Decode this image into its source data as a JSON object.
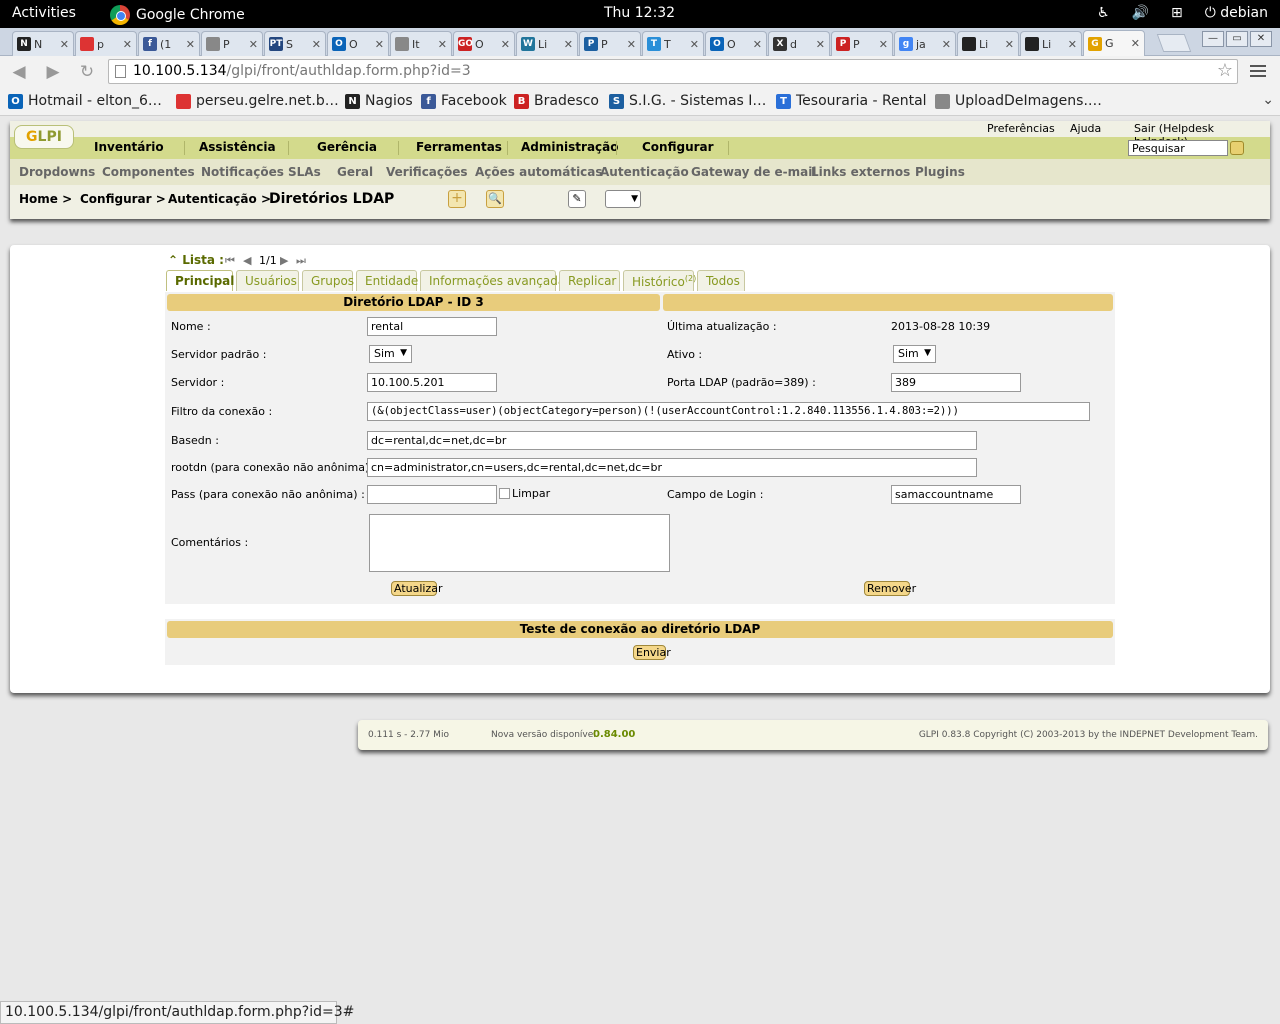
{
  "os_bar": {
    "activities": "Activities",
    "app": "Google Chrome",
    "clock": "Thu 12:32",
    "user": "debian"
  },
  "tabs": [
    {
      "title": "N",
      "icon": "N",
      "color": "#222"
    },
    {
      "title": "p",
      "icon": "",
      "color": "#d33"
    },
    {
      "title": "(1",
      "icon": "f",
      "color": "#3b5998"
    },
    {
      "title": "P",
      "icon": "",
      "color": "#888"
    },
    {
      "title": "S",
      "icon": "PT",
      "color": "#24477f"
    },
    {
      "title": "O",
      "icon": "O",
      "color": "#0a64b8"
    },
    {
      "title": "It",
      "icon": "",
      "color": "#888"
    },
    {
      "title": "O",
      "icon": "GO",
      "color": "#c22"
    },
    {
      "title": "Li",
      "icon": "W",
      "color": "#21759b"
    },
    {
      "title": "P",
      "icon": "P",
      "color": "#1c5fa0"
    },
    {
      "title": "T",
      "icon": "T",
      "color": "#2a8fd8"
    },
    {
      "title": "O",
      "icon": "O",
      "color": "#0a64b8"
    },
    {
      "title": "d",
      "icon": "X",
      "color": "#333"
    },
    {
      "title": "P",
      "icon": "P",
      "color": "#c22"
    },
    {
      "title": "ja",
      "icon": "g",
      "color": "#4285f4"
    },
    {
      "title": "Li",
      "icon": "",
      "color": "#222"
    },
    {
      "title": "Li",
      "icon": "",
      "color": "#222"
    },
    {
      "title": "G",
      "icon": "G",
      "color": "#e2a200"
    }
  ],
  "url": {
    "host": "10.100.5.134",
    "path": "/glpi/front/authldap.form.php?id=3"
  },
  "bookmarks": [
    {
      "label": "Hotmail - elton_6…",
      "icon": "O",
      "color": "#0a64b8"
    },
    {
      "label": "perseu.gelre.net.b…",
      "icon": "",
      "color": "#d33"
    },
    {
      "label": "Nagios",
      "icon": "N",
      "color": "#222"
    },
    {
      "label": "Facebook",
      "icon": "f",
      "color": "#3b5998"
    },
    {
      "label": "Bradesco",
      "icon": "B",
      "color": "#c22"
    },
    {
      "label": "S.I.G. - Sistemas I…",
      "icon": "S",
      "color": "#1c5fa0"
    },
    {
      "label": "Tesouraria - Rental",
      "icon": "T",
      "color": "#2a6fd8"
    },
    {
      "label": "UploadDeImagens.…",
      "icon": "",
      "color": "#888"
    }
  ],
  "glpi": {
    "logo": "GLPI",
    "main_menu": [
      "Inventário",
      "Assistência",
      "Gerência",
      "Ferramentas",
      "Administração",
      "Configurar"
    ],
    "top_links": [
      "Preferências",
      "Ajuda",
      "Sair (Helpdesk helpdesk)"
    ],
    "search_placeholder": "Pesquisar",
    "sub_menu": [
      "Dropdowns",
      "Componentes",
      "Notificações",
      "SLAs",
      "Geral",
      "Verificações",
      "Ações automáticas",
      "Autenticação",
      "Gateway de e-mail",
      "Links externos",
      "Plugins"
    ],
    "breadcrumb": [
      "Home >",
      "Configurar >",
      "Autenticação >"
    ],
    "page_title": "Diretórios LDAP"
  },
  "list_nav": {
    "label": "Lista :",
    "position": "1/1"
  },
  "form_tabs": [
    "Principal",
    "Usuários",
    "Grupos",
    "Entidade",
    "Informações avançadas",
    "Replicar",
    "Histórico",
    "Todos"
  ],
  "history_count": "(2)",
  "form": {
    "title": "Diretório LDAP - ID 3",
    "name_label": "Nome :",
    "name_value": "rental",
    "last_update_label": "Última atualização :",
    "last_update_value": "2013-08-28 10:39",
    "default_server_label": "Servidor padrão :",
    "default_server_value": "Sim",
    "active_label": "Ativo :",
    "active_value": "Sim",
    "server_label": "Servidor :",
    "server_value": "10.100.5.201",
    "port_label": "Porta LDAP (padrão=389) :",
    "port_value": "389",
    "filter_label": "Filtro da conexão :",
    "filter_value": "(&(objectClass=user)(objectCategory=person)(!(userAccountControl:1.2.840.113556.1.4.803:=2)))",
    "basedn_label": "Basedn :",
    "basedn_value": "dc=rental,dc=net,dc=br",
    "rootdn_label": "rootdn (para conexão não anônima) :",
    "rootdn_value": "cn=administrator,cn=users,dc=rental,dc=net,dc=br",
    "pass_label": "Pass (para conexão não anônima) :",
    "pass_value": "",
    "clear_label": "Limpar",
    "login_label": "Campo de Login :",
    "login_value": "samaccountname",
    "comments_label": "Comentários :",
    "update_button": "Atualizar",
    "remove_button": "Remover"
  },
  "test": {
    "title": "Teste de conexão ao diretório LDAP",
    "send_button": "Enviar"
  },
  "footer": {
    "stats": "0.111 s - 2.77 Mio",
    "new_version_label": "Nova versão disponível",
    "new_version": "0.84.00",
    "copyright": "GLPI 0.83.8 Copyright (C) 2003-2013 by the INDEPNET Development Team."
  },
  "status_url": "10.100.5.134/glpi/front/authldap.form.php?id=3#"
}
